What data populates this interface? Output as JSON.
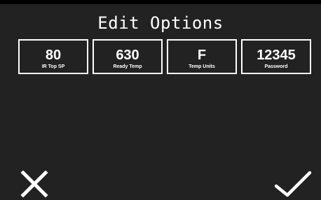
{
  "screen": {
    "title": "Edit Options",
    "background": "#222222",
    "foreground": "#ffffff"
  },
  "options": [
    {
      "value": "80",
      "label": "IR Top SP"
    },
    {
      "value": "630",
      "label": "Ready Temp"
    },
    {
      "value": "F",
      "label": "Temp Units"
    },
    {
      "value": "12345",
      "label": "Password"
    }
  ],
  "actions": {
    "cancel_icon": "close-icon",
    "confirm_icon": "checkmark-icon"
  }
}
